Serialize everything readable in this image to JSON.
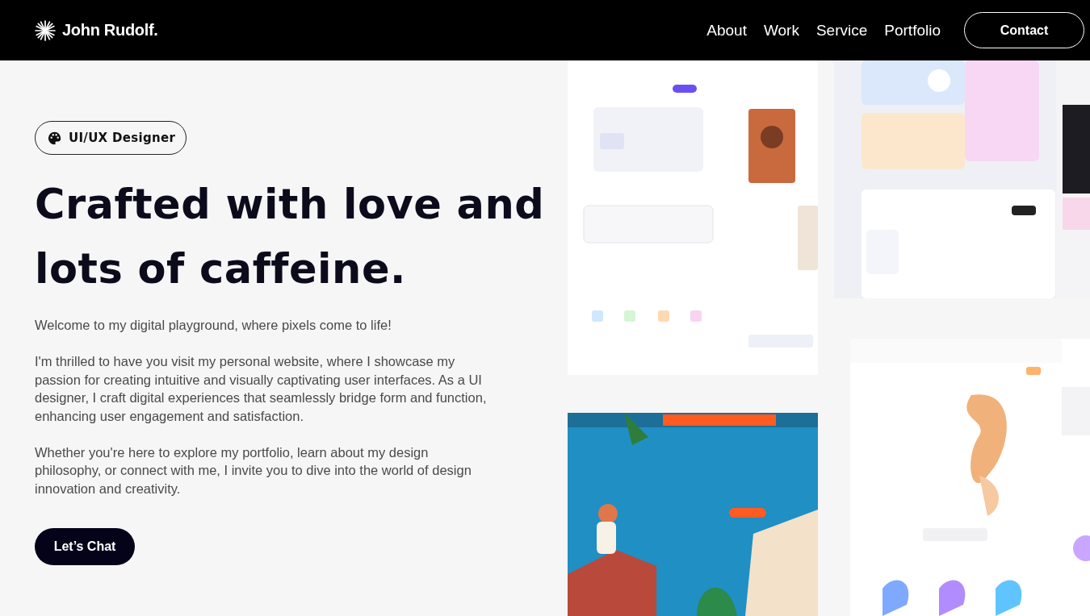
{
  "header": {
    "logo": "John Rudolf.",
    "nav": [
      "About",
      "Work",
      "Service",
      "Portfolio"
    ],
    "contact": "Contact"
  },
  "hero": {
    "badge": "UI/UX Designer",
    "title_lines": [
      "Crafted with love and",
      "lots of caffeine."
    ],
    "paragraphs": [
      "Welcome to my digital playground, where pixels come to life!",
      "I'm thrilled to have you visit my personal website, where I showcase my passion for creating intuitive and visually captivating user interfaces. As a UI designer, I craft digital experiences that seamlessly bridge form and function, enhancing user engagement and satisfaction.",
      "Whether you're here to explore my portfolio, learn about my design philosophy, or connect with me, I invite you to dive into the world of design innovation and creativity."
    ],
    "cta": "Let’s Chat"
  }
}
